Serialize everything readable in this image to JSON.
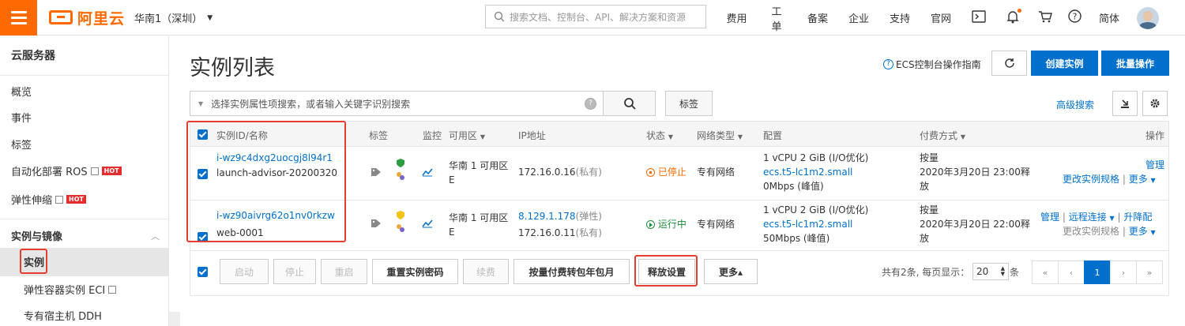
{
  "header": {
    "logo_text": "阿里云",
    "region": "华南1（深圳）",
    "search_placeholder": "搜索文档、控制台、API、解决方案和资源",
    "nav": [
      "费用",
      "工单",
      "备案",
      "企业",
      "支持",
      "官网"
    ],
    "lang": "简体",
    "accent": "#ff6a00"
  },
  "sidebar": {
    "title": "云服务器",
    "items": [
      {
        "label": "概览"
      },
      {
        "label": "事件"
      },
      {
        "label": "标签"
      },
      {
        "label": "自动化部署 ROS",
        "badge": "HOT"
      },
      {
        "label": "弹性伸缩",
        "badge": "HOT"
      }
    ],
    "section": "实例与镜像",
    "sub_items": [
      {
        "label": "实例"
      },
      {
        "label": "弹性容器实例 ECI"
      },
      {
        "label": "专有宿主机 DDH"
      }
    ]
  },
  "page": {
    "title": "实例列表",
    "guide": "ECS控制台操作指南",
    "create_btn": "创建实例",
    "batch_btn": "批量操作",
    "filter_placeholder": "选择实例属性项搜索，或者输入关键字识别搜索",
    "tag_btn": "标签",
    "advanced_search": "高级搜索"
  },
  "table": {
    "headers": {
      "id": "实例ID/名称",
      "tag": "标签",
      "monitor": "监控",
      "zone": "可用区",
      "ip": "IP地址",
      "status": "状态",
      "network": "网络类型",
      "config": "配置",
      "billing": "付费方式",
      "ops": "操作"
    },
    "rows": [
      {
        "id": "i-wz9c4dxg2uocgj8l94r1",
        "name": "launch-advisor-20200320",
        "zone_line1": "华南 1 可用区",
        "zone_line2": "E",
        "ip1": "",
        "ip1_note": "",
        "ip2": "172.16.0.16",
        "ip2_note": "(私有)",
        "status": "已停止",
        "network": "专有网络",
        "config1": "1 vCPU 2 GiB (I/O优化)",
        "config2": "ecs.t5-lc1m2.small",
        "config3": "0Mbps (峰值)",
        "billing1": "按量",
        "billing2": "2020年3月20日 23:00释",
        "billing3": "放",
        "op1": "管理",
        "op2": "更改实例规格",
        "op3": "更多"
      },
      {
        "id": "i-wz90aivrg62o1nv0rkzw",
        "name": "web-0001",
        "zone_line1": "华南 1 可用区",
        "zone_line2": "E",
        "ip1": "8.129.1.178",
        "ip1_note": "(弹性)",
        "ip2": "172.16.0.11",
        "ip2_note": "(私有)",
        "status": "运行中",
        "network": "专有网络",
        "config1": "1 vCPU 2 GiB (I/O优化)",
        "config2": "ecs.t5-lc1m2.small",
        "config3": "50Mbps (峰值)",
        "billing1": "按量",
        "billing2": "2020年3月20日 22:00释",
        "billing3": "放",
        "op1": "管理",
        "op_remote": "远程连接",
        "op_upgrade": "升降配",
        "op2": "更改实例规格",
        "op3": "更多"
      }
    ]
  },
  "footer": {
    "start": "启动",
    "stop": "停止",
    "restart": "重启",
    "reset_pwd": "重置实例密码",
    "renew": "续费",
    "convert": "按量付费转包年包月",
    "release": "释放设置",
    "more": "更多▴",
    "total": "共有2条, 每页显示：",
    "page_size": "20",
    "unit": "条",
    "pages": [
      "«",
      "‹",
      "1",
      "›",
      "»"
    ]
  }
}
